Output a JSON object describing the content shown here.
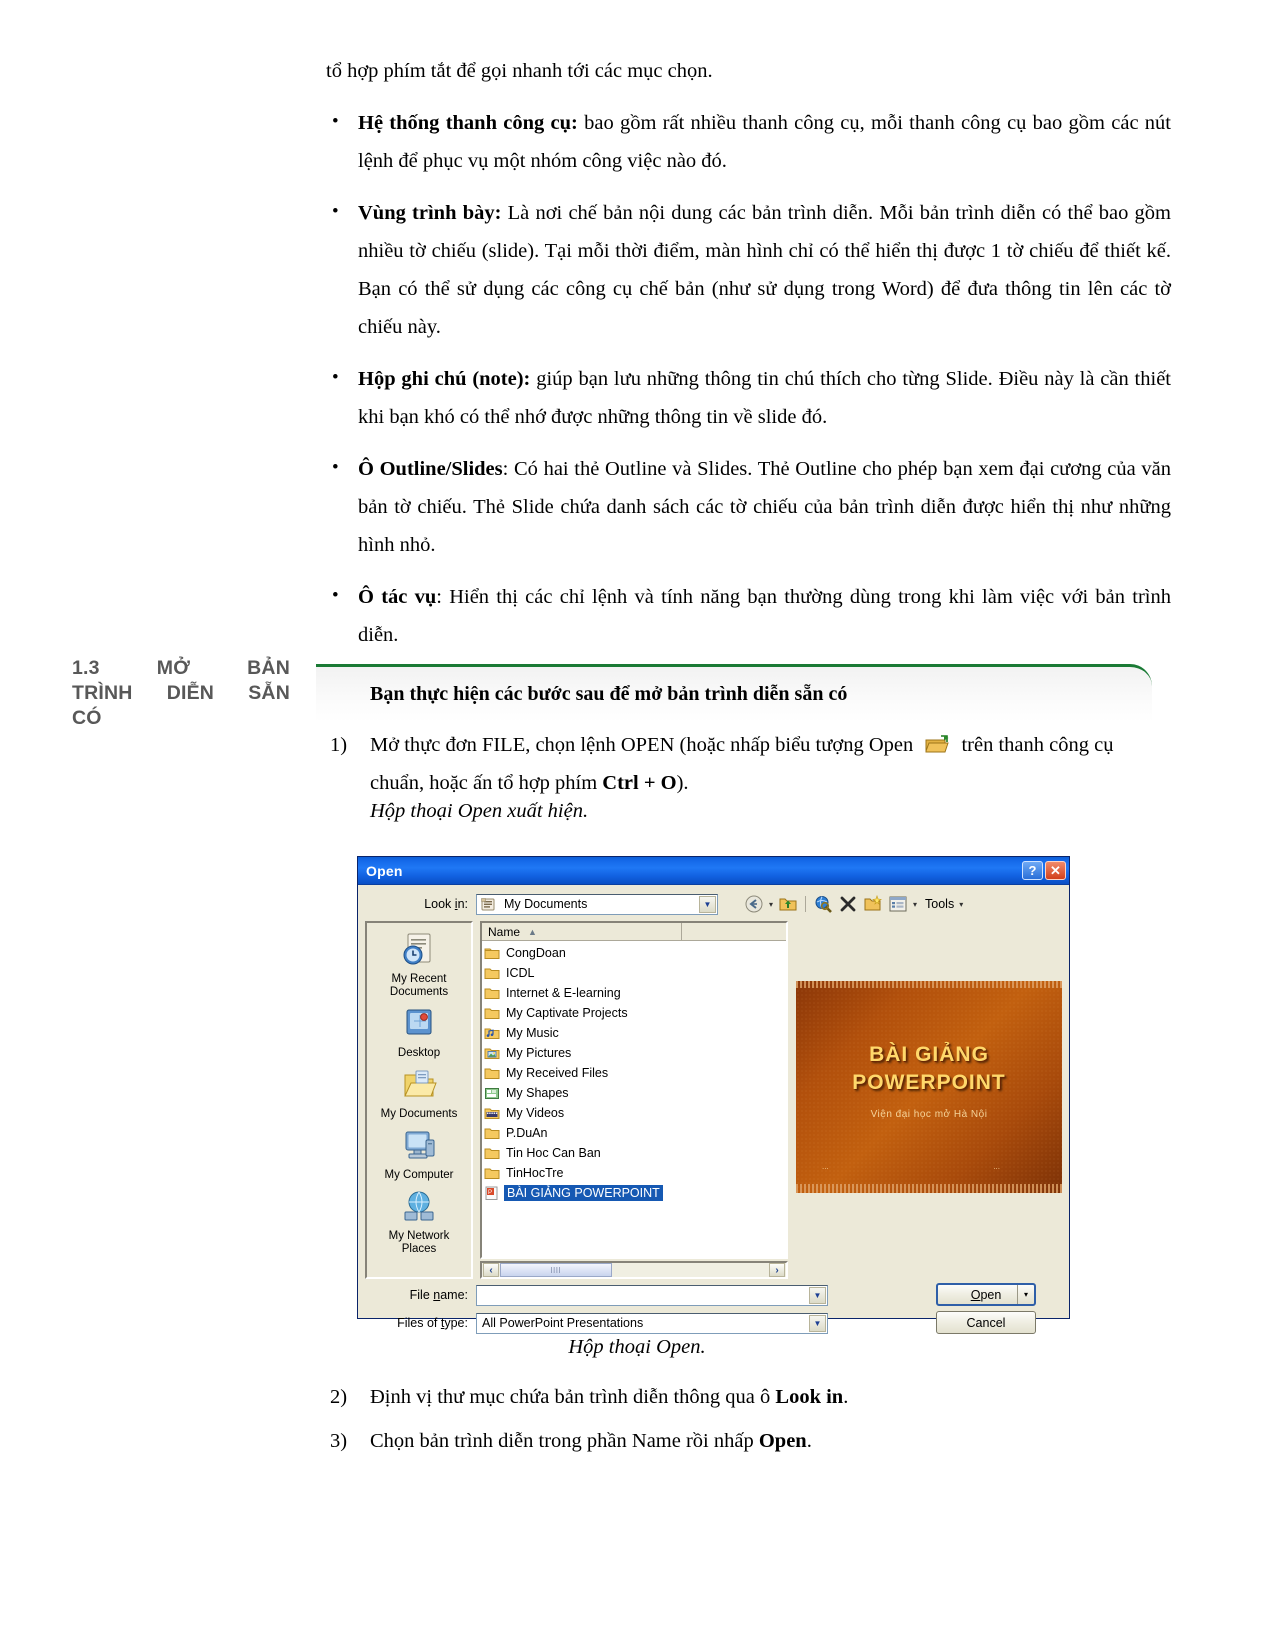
{
  "doc": {
    "lead": "tổ hợp phím tắt để gọi nhanh tới các mục chọn.",
    "bullets": [
      {
        "bold": "Hệ thống thanh công cụ:",
        "text": " bao gồm rất nhiều thanh công cụ, mỗi thanh công cụ bao gồm các nút lệnh để phục vụ một nhóm công việc nào đó."
      },
      {
        "bold": "Vùng trình bày:",
        "text": " Là nơi chế bản nội dung các bản trình diễn. Mỗi bản trình diễn có thể bao gồm nhiều tờ chiếu (slide). Tại mỗi thời điểm, màn hình chỉ có thể hiển thị được 1 tờ chiếu để thiết kế. Bạn có thể sử dụng các công cụ chế bản (như sử dụng trong Word) để đưa thông tin lên các tờ chiếu này."
      },
      {
        "bold": "Hộp ghi chú (note):",
        "text": " giúp bạn lưu những thông tin chú thích cho từng Slide. Điều này là cần thiết khi bạn khó có thể nhớ được những thông tin  về slide đó."
      },
      {
        "bold": "Ô Outline/Slides",
        "text": ": Có hai thẻ Outline và Slides. Thẻ Outline cho phép bạn xem đại cương của văn bản tờ chiếu. Thẻ Slide chứa danh sách các tờ chiếu của bản trình diễn được hiển thị như những hình nhỏ."
      },
      {
        "bold": "Ô tác vụ",
        "text": ": Hiển thị các chỉ lệnh và tính năng bạn thường dùng trong khi làm việc với bản trình diễn."
      }
    ],
    "section": {
      "number": "1.3",
      "title_line1_a": "MỞ",
      "title_line1_b": "BẢN",
      "title_line2_a": "TRÌNH",
      "title_line2_b": "DIỄN",
      "title_line2_c": "SẴN",
      "title_line3": "CÓ"
    },
    "callout_heading": "Bạn thực hiện các bước sau để mở bản trình diễn sẵn có",
    "steps": [
      {
        "num": "1)",
        "pre": "Mở thực đơn FILE, chọn lệnh OPEN (hoặc nhấp biểu tượng Open",
        "post": "trên thanh công cụ chuẩn, hoặc ấn tổ hợp phím ",
        "bold": "Ctrl + O",
        "tail": ")."
      }
    ],
    "note_italic": "Hộp thoại Open xuất hiện.",
    "figure_caption": "Hộp thoại Open.",
    "steps_after": [
      {
        "num": "2)",
        "pre": "Định vị thư mục chứa bản trình diễn thông qua ô ",
        "bold": "Look in",
        "tail": "."
      },
      {
        "num": "3)",
        "pre": "Chọn bản trình diễn trong phần Name rồi nhấp ",
        "bold": "Open",
        "tail": "."
      }
    ]
  },
  "dialog": {
    "title": "Open",
    "help_button": "?",
    "close_button": "✕",
    "lookin": {
      "label_pre": "Look ",
      "label_accel": "i",
      "label_post": "n:",
      "value": "My Documents",
      "dropdown_arrow": "▼",
      "icon": "my-documents-icon"
    },
    "toolbar": {
      "back_icon": "back-navigate-icon",
      "back_caret": "▾",
      "up_icon": "up-one-level-icon",
      "search_icon": "search-web-icon",
      "delete_icon": "delete-icon",
      "newfolder_icon": "create-new-folder-icon",
      "views_icon": "views-icon",
      "views_caret": "▾",
      "tools_label": "Tools",
      "tools_caret": "▾"
    },
    "places": [
      {
        "icon": "my-recent-documents-icon",
        "line1": "My Recent",
        "line2": "Documents"
      },
      {
        "icon": "desktop-icon",
        "line1": "Desktop",
        "line2": ""
      },
      {
        "icon": "my-documents-icon",
        "line1": "My Documents",
        "line2": ""
      },
      {
        "icon": "my-computer-icon",
        "line1": "My Computer",
        "line2": ""
      },
      {
        "icon": "my-network-places-icon",
        "line1": "My Network",
        "line2": "Places"
      }
    ],
    "filelist": {
      "columns": [
        "Name",
        ""
      ],
      "sort_arrow": "▲",
      "rows": [
        {
          "name": "CongDoan",
          "icon": "folder-icon",
          "selected": false
        },
        {
          "name": "ICDL",
          "icon": "folder-icon",
          "selected": false
        },
        {
          "name": "Internet & E-learning",
          "icon": "folder-icon",
          "selected": false
        },
        {
          "name": "My Captivate Projects",
          "icon": "folder-icon",
          "selected": false
        },
        {
          "name": "My Music",
          "icon": "music-folder-icon",
          "selected": false
        },
        {
          "name": "My Pictures",
          "icon": "pictures-folder-icon",
          "selected": false
        },
        {
          "name": "My Received Files",
          "icon": "folder-icon",
          "selected": false
        },
        {
          "name": "My Shapes",
          "icon": "shapes-folder-icon",
          "selected": false
        },
        {
          "name": "My Videos",
          "icon": "videos-folder-icon",
          "selected": false
        },
        {
          "name": "P.DuAn",
          "icon": "folder-icon",
          "selected": false
        },
        {
          "name": "Tin Hoc Can Ban",
          "icon": "folder-icon",
          "selected": false
        },
        {
          "name": "TinHocTre",
          "icon": "folder-icon",
          "selected": false
        },
        {
          "name": "BÀI GIẢNG POWERPOINT",
          "icon": "powerpoint-file-icon",
          "selected": true
        }
      ],
      "scroll_left": "‹",
      "scroll_right": "›",
      "thumb_grip": "llll"
    },
    "preview": {
      "title_line1": "BÀI GIẢNG",
      "title_line2": "POWERPOINT",
      "subtitle": "Viện đại học mở Hà Nội",
      "footer_left": "...",
      "footer_right": "..."
    },
    "filename": {
      "label_pre": "File ",
      "label_accel": "n",
      "label_post": "ame:",
      "value": "",
      "dropdown_arrow": "▼"
    },
    "filetype": {
      "label_pre": "Files of ",
      "label_accel": "t",
      "label_post": "ype:",
      "value": "All PowerPoint Presentations",
      "dropdown_arrow": "▼"
    },
    "buttons": {
      "open_pre": "",
      "open_accel": "O",
      "open_post": "pen",
      "open_split": "▾",
      "cancel": "Cancel"
    },
    "colors": {
      "titlebar_blue": "#1468e8",
      "selection_blue": "#1659b3",
      "dialog_face": "#ece9d8",
      "callout_green": "#1a7a35",
      "section_gray": "#585858",
      "slide_orange": "#b2500c"
    }
  }
}
